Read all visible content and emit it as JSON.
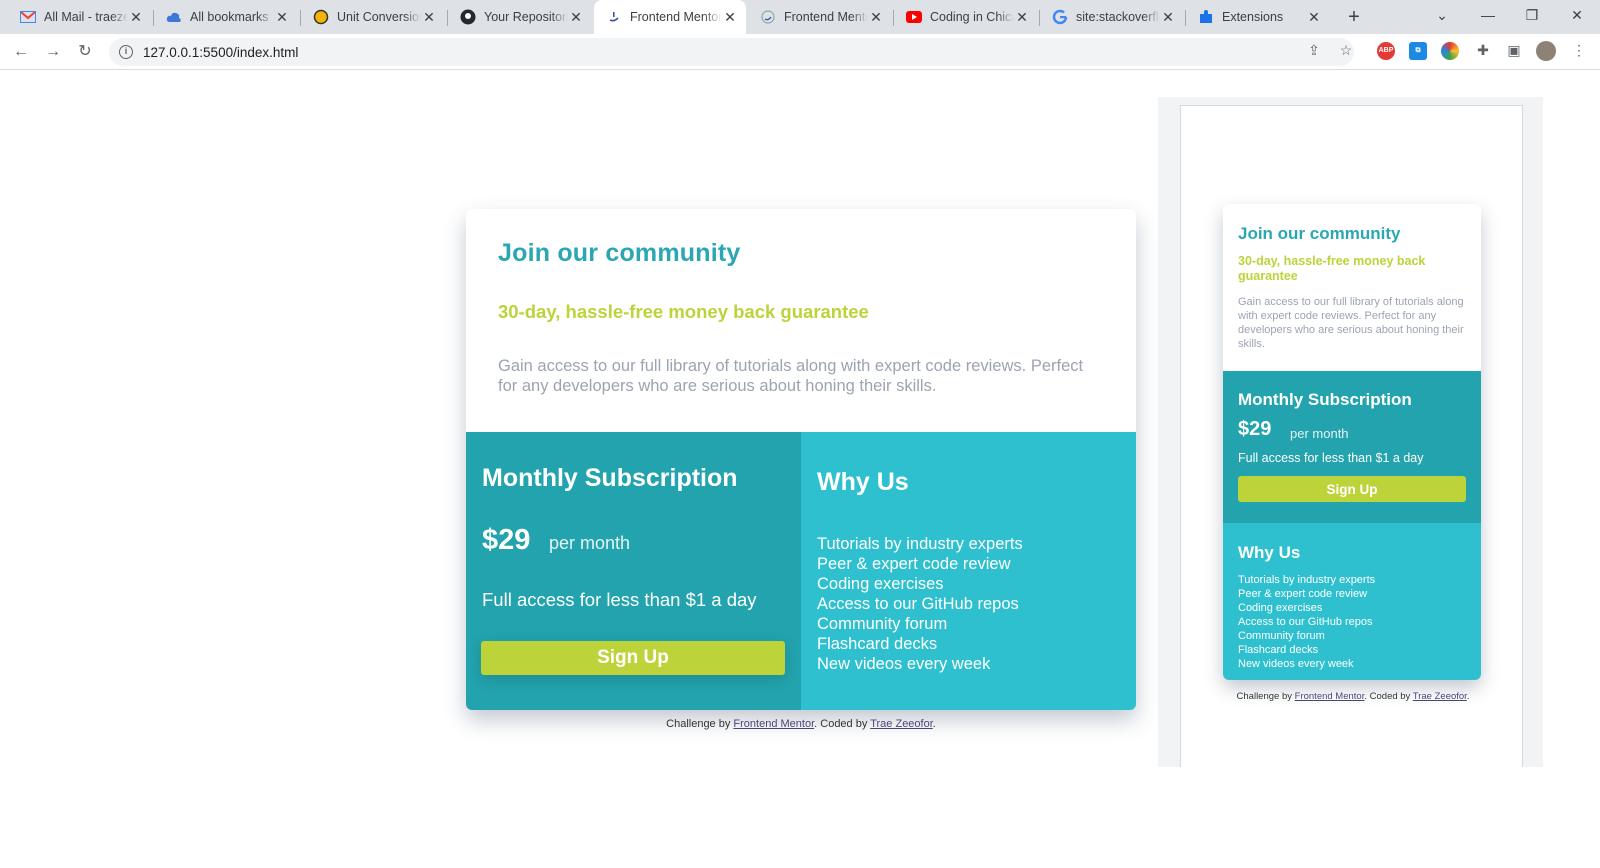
{
  "browser": {
    "tabs": [
      {
        "label": "All Mail - traeze",
        "icon": "gmail-icon",
        "active": false
      },
      {
        "label": "All bookmarks",
        "icon": "cloud-icon",
        "active": false
      },
      {
        "label": "Unit Conversion",
        "icon": "circle-icon",
        "active": false
      },
      {
        "label": "Your Repositories",
        "icon": "github-icon",
        "active": false
      },
      {
        "label": "Frontend Mentor",
        "icon": "frontend-mentor-icon",
        "active": true
      },
      {
        "label": "Frontend Mentor",
        "icon": "frontend-mentor-icon",
        "active": false
      },
      {
        "label": "Coding in Chicago",
        "icon": "youtube-icon",
        "active": false
      },
      {
        "label": "site:stackoverflow",
        "icon": "google-icon",
        "active": false
      },
      {
        "label": "Extensions",
        "icon": "puzzle-icon",
        "active": false
      }
    ],
    "url": "127.0.0.1:5500/index.html"
  },
  "card": {
    "title": "Join our community",
    "guarantee": "30-day, hassle-free money back guarantee",
    "description": "Gain access to our full library of tutorials along with expert code reviews. Perfect for any developers who are serious about honing their skills.",
    "subscription": {
      "title": "Monthly Subscription",
      "price": "$29",
      "per": "per month",
      "full_access": "Full access for less than $1 a day",
      "signup_label": "Sign Up"
    },
    "why": {
      "title": "Why Us",
      "items": [
        "Tutorials by industry experts",
        "Peer & expert code review",
        "Coding exercises",
        "Access to our GitHub repos",
        "Community forum",
        "Flashcard decks",
        "New videos every week"
      ]
    }
  },
  "attribution": {
    "prefix": "Challenge by ",
    "link1": "Frontend Mentor",
    "middle": ". Coded by ",
    "link2": "Trae Zeeofor",
    "suffix": "."
  },
  "colors": {
    "cyan_dark": "#22a3ad",
    "cyan_light": "#2fc0cf",
    "lime": "#bdd33a",
    "title_teal": "#2aa7b3",
    "grey_text": "#9ca3b2"
  }
}
